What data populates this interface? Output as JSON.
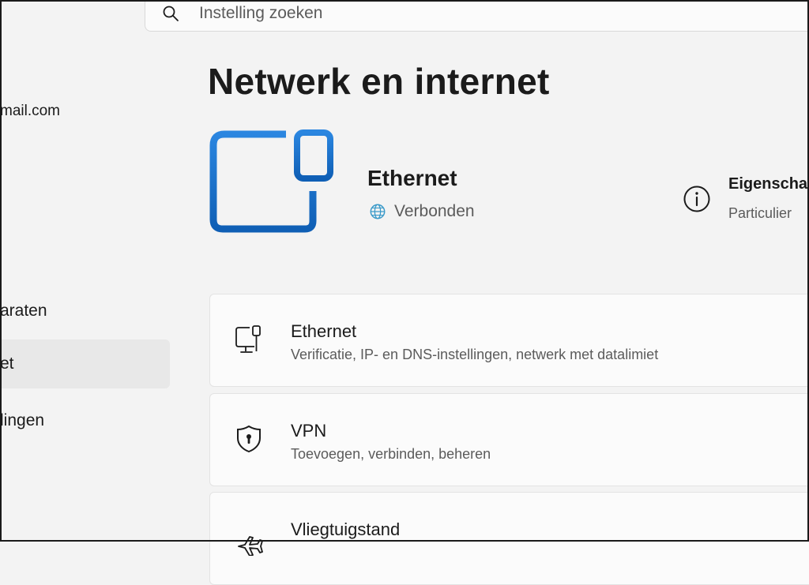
{
  "search": {
    "placeholder": "Instelling zoeken"
  },
  "sidebar": {
    "account_email": "mail.com",
    "items": [
      {
        "label": "araten"
      },
      {
        "label": "et",
        "selected": true
      },
      {
        "label": "lingen"
      }
    ]
  },
  "main": {
    "title": "Netwerk en internet",
    "connection": {
      "name": "Ethernet",
      "status": "Verbonden"
    },
    "properties": {
      "title": "Eigenscha",
      "subtitle": "Particulier"
    },
    "cards": [
      {
        "title": "Ethernet",
        "subtitle": "Verificatie, IP- en DNS-instellingen, netwerk met datalimiet",
        "icon": "ethernet-icon"
      },
      {
        "title": "VPN",
        "subtitle": "Toevoegen, verbinden, beheren",
        "icon": "shield-icon"
      },
      {
        "title": "Vliegtuigstand",
        "subtitle": "",
        "icon": "airplane-icon"
      }
    ]
  },
  "colors": {
    "accent": "#0f6cbd",
    "accent_light": "#2b86e0",
    "globe": "#3a9ac9"
  }
}
